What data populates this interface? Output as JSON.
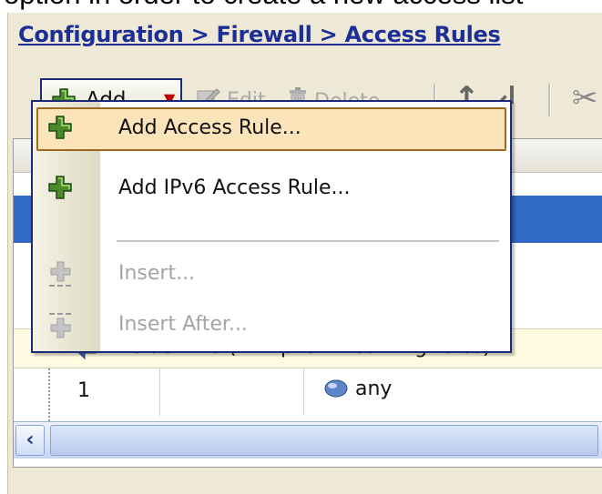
{
  "caption": "option in order to create a new access list",
  "breadcrumb": "Configuration > Firewall > Access Rules",
  "toolbar": {
    "add_label": "Add",
    "edit_label": "Edit",
    "delete_label": "Delete"
  },
  "menu": {
    "items": [
      {
        "label": "Add Access Rule...",
        "enabled": true,
        "highlighted": true,
        "icon": "plus-icon"
      },
      {
        "label": "Add IPv6 Access Rule...",
        "enabled": true,
        "highlighted": false,
        "icon": "plus-icon"
      },
      {
        "label": "Insert...",
        "enabled": false,
        "highlighted": false,
        "icon": "insert-icon"
      },
      {
        "label": "Insert After...",
        "enabled": false,
        "highlighted": false,
        "icon": "insert-after-icon"
      }
    ]
  },
  "grid": {
    "interface_row_text": "inside IPv6 (2 implicit incoming rules)",
    "rows": [
      {
        "number": "1",
        "destination": "any"
      }
    ]
  },
  "colors": {
    "accent": "#3169c6",
    "link": "#1d2f96",
    "highlight": "#fbe3ba"
  }
}
